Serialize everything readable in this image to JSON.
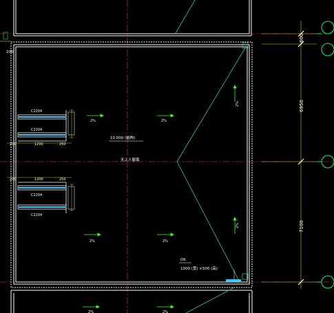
{
  "colors": {
    "background": "#000000",
    "wall": "#ffffff",
    "axis": "#ff3b30",
    "grid_bubble": "#00ff66",
    "slope_line": "#27c98a",
    "arrow": "#39ff14",
    "window_glass": "#33ccff",
    "dim_line": "#d0d000",
    "text": "#ffffff"
  },
  "dimensions": {
    "d600": "600",
    "d6950": "6950",
    "d7100": "7100",
    "d200_left": "200"
  },
  "labels": {
    "elevation": "10.000 (结构)",
    "room": "无上人屋面",
    "opening_code": "DK",
    "opening_size": "1000 (宽) ×500 (高)"
  },
  "windows": [
    {
      "code": "C2204",
      "pos": "upper-a"
    },
    {
      "code": "C2204",
      "pos": "upper-b"
    },
    {
      "code": "C2204",
      "pos": "lower-a"
    },
    {
      "code": "C2204",
      "pos": "lower-b"
    }
  ],
  "window_dims": {
    "w1": "200",
    "w2": "1200",
    "w3": "250"
  },
  "slopes": [
    {
      "text": "2%",
      "id": "s1"
    },
    {
      "text": "2%",
      "id": "s2"
    },
    {
      "text": "2%",
      "id": "s3"
    },
    {
      "text": "2%",
      "id": "s4"
    },
    {
      "text": "2%",
      "id": "s5"
    },
    {
      "text": "2%",
      "id": "s6"
    },
    {
      "text": "2%",
      "id": "s7"
    },
    {
      "text": "2%",
      "id": "s8"
    }
  ]
}
